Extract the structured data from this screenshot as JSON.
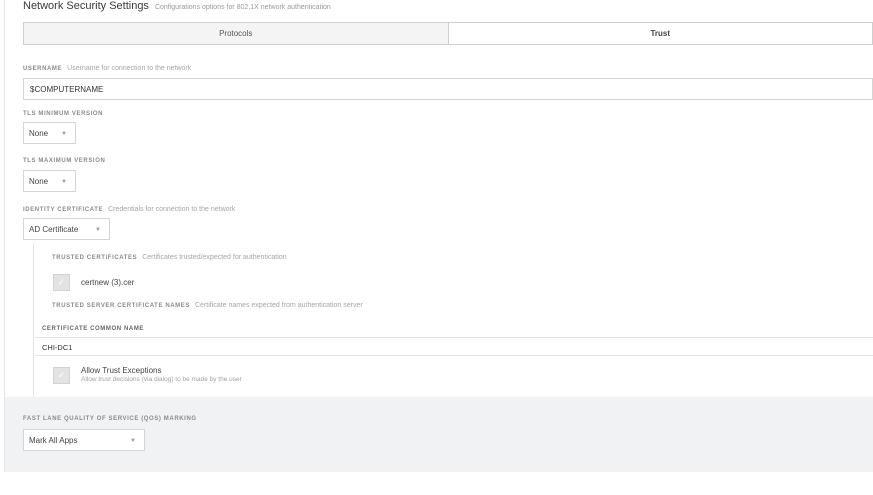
{
  "header": {
    "title": "Network Security Settings",
    "description": "Configurations options for 802.1X network authentication"
  },
  "tabs": [
    {
      "label": "Protocols",
      "active": false
    },
    {
      "label": "Trust",
      "active": true
    }
  ],
  "username": {
    "label": "USERNAME",
    "description": "Username for connection to the network",
    "value": "$COMPUTERNAME"
  },
  "tls_min": {
    "label": "TLS MINIMUM VERSION",
    "value": "None"
  },
  "tls_max": {
    "label": "TLS MAXIMUM VERSION",
    "value": "None"
  },
  "identity": {
    "label": "IDENTITY CERTIFICATE",
    "description": "Credentials for connection to the network",
    "value": "AD Certificate"
  },
  "trusted_certs": {
    "label": "TRUSTED CERTIFICATES",
    "description": "Certificates trusted/expected for authentication",
    "items": [
      {
        "name": "certnew (3).cer",
        "checked": true
      }
    ]
  },
  "trusted_server_names": {
    "label": "TRUSTED SERVER CERTIFICATE NAMES",
    "description": "Certificate names expected from authentication server",
    "column_header": "CERTIFICATE COMMON NAME",
    "rows": [
      "CHI-DC1"
    ]
  },
  "trust_exceptions": {
    "label": "Allow Trust Exceptions",
    "description": "Allow trust decisions (via dialog) to be made by the user",
    "checked": true
  },
  "fastlane": {
    "label": "FAST LANE QUALITY OF SERVICE (QOS) MARKING",
    "value": "Mark All Apps"
  },
  "icons": {
    "dropdown": "chevron-down-icon",
    "check": "checkmark-icon"
  },
  "colors": {
    "panel_background": "#ffffff",
    "band_background": "#f1f2f4",
    "border": "#d5d5d5"
  }
}
